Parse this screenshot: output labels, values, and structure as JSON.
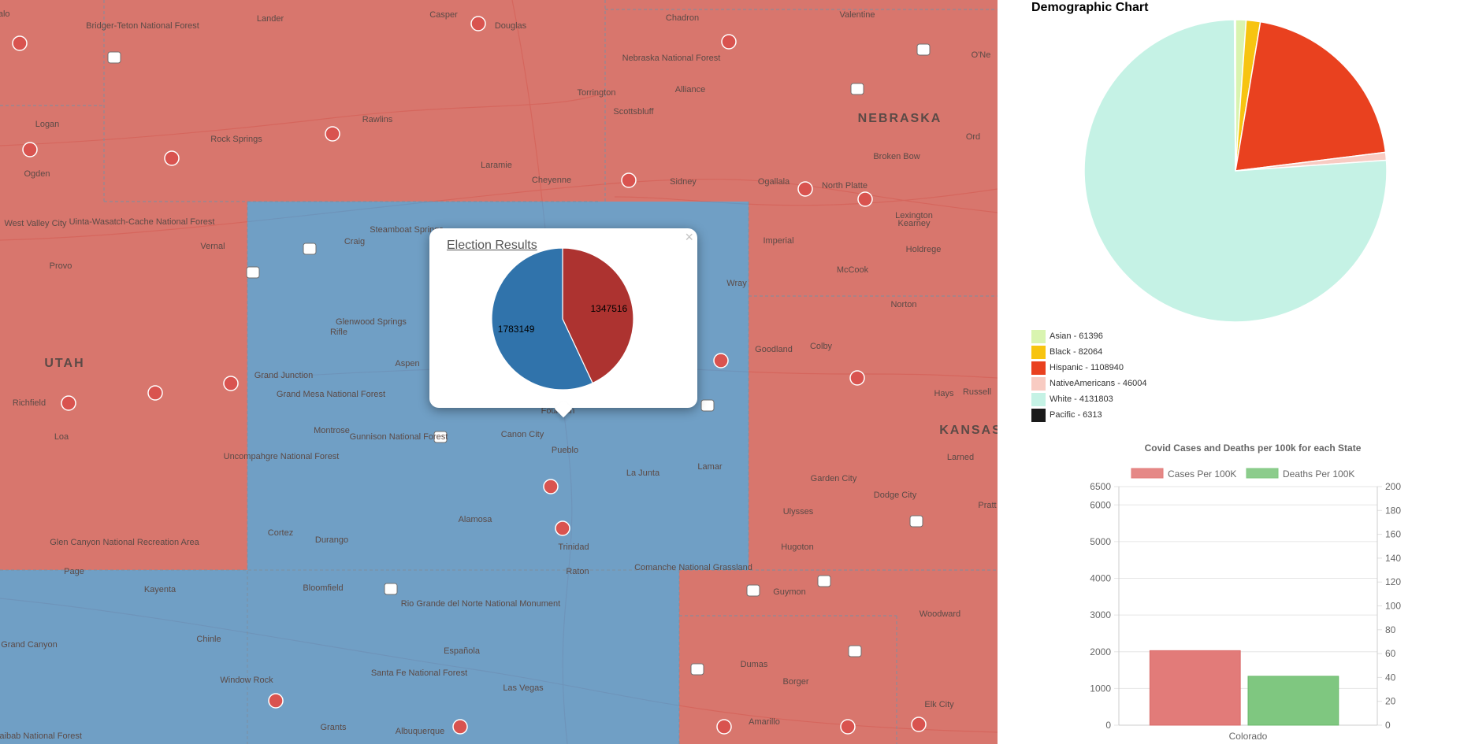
{
  "map": {
    "place_labels": [
      "Etalo",
      "Lander",
      "Casper",
      "Douglas",
      "Chadron",
      "Valentine",
      "O'Ne",
      "Bridger-Teton National Forest",
      "Nebraska National Forest",
      "Torrington",
      "Alliance",
      "Scottsbluff",
      "Rawlins",
      "Rock Springs",
      "Laramie",
      "Cheyenne",
      "Sidney",
      "Ogallala",
      "North Platte",
      "Kearney",
      "Lexington",
      "Broken Bow",
      "Ord",
      "NEBRASKA",
      "Logan",
      "Ogden",
      "West Valley City",
      "Uinta-Wasatch-Cache National Forest",
      "Vernal",
      "Provo",
      "UTAH",
      "Richfield",
      "Loa",
      "Steamboat Springs",
      "Craig",
      "Imperial",
      "McCook",
      "Holdrege",
      "Wray",
      "Glenwood Springs",
      "Rifle",
      "Aspen",
      "Grand Junction",
      "Grand Mesa National Forest",
      "Goodland",
      "Colby",
      "Norton",
      "Hays",
      "Russell",
      "KANSAS",
      "Montrose",
      "Gunnison National Forest",
      "Uncompahgre National Forest",
      "Canon City",
      "Pueblo",
      "La Junta",
      "Lamar",
      "Garden City",
      "Dodge City",
      "Larned",
      "Pratt",
      "Ulysses",
      "Hugoton",
      "Alamosa",
      "Cortez",
      "Durango",
      "Trinidad",
      "Comanche National Grassland",
      "Glen Canyon National Recreation Area",
      "Page",
      "Kayenta",
      "Bloomfield",
      "Rio Grande del Norte National Monument",
      "Guymon",
      "Woodward",
      "Grand Canyon",
      "Chinle",
      "Española",
      "Santa Fe National Forest",
      "Las Vegas",
      "Window Rock",
      "Dumas",
      "Borger",
      "Elk City",
      "Amarillo",
      "Grants",
      "Albuquerque",
      "Kaibab National Forest",
      "Raton",
      "Fountain"
    ]
  },
  "popup": {
    "title": "Election Results",
    "close_label": "×",
    "results": [
      {
        "value": 1783149,
        "color": "#3073ab"
      },
      {
        "value": 1347516,
        "color": "#ad3330"
      }
    ]
  },
  "demographic": {
    "title": "Demographic Chart",
    "legend": [
      {
        "label": "Asian - 61396",
        "color": "#d9f4b0"
      },
      {
        "label": "Black - 82064",
        "color": "#f7c411"
      },
      {
        "label": "Hispanic - 1108940",
        "color": "#e9411f"
      },
      {
        "label": "NativeAmericans - 46004",
        "color": "#f8cbc2"
      },
      {
        "label": "White - 4131803",
        "color": "#c5f2e5"
      },
      {
        "label": "Pacific - 6313",
        "color": "#1a1a1a"
      }
    ]
  },
  "chart_data": [
    {
      "type": "pie",
      "title": "Election Results",
      "labels": [
        "",
        ""
      ],
      "values": [
        1783149,
        1347516
      ],
      "colors": [
        "#3073ab",
        "#ad3330"
      ]
    },
    {
      "type": "pie",
      "title": "Demographic Chart",
      "labels": [
        "Asian",
        "Black",
        "Hispanic",
        "NativeAmericans",
        "White",
        "Pacific"
      ],
      "values": [
        61396,
        82064,
        1108940,
        46004,
        4131803,
        6313
      ],
      "colors": [
        "#d9f4b0",
        "#f7c411",
        "#e9411f",
        "#f8cbc2",
        "#c5f2e5",
        "#1a1a1a"
      ],
      "legend": "bottom-left"
    },
    {
      "type": "bar",
      "title": "Covid Cases and Deaths per 100k for each State",
      "categories": [
        "Colorado"
      ],
      "series": [
        {
          "name": "Cases Per 100K",
          "values": [
            2030
          ],
          "axis": "left",
          "color": "#e27b79"
        },
        {
          "name": "Deaths Per 100K",
          "values": [
            41
          ],
          "axis": "right",
          "color": "#7fc780"
        }
      ],
      "y_left": {
        "ticks": [
          0,
          1000,
          2000,
          3000,
          4000,
          5000,
          6000,
          6500
        ],
        "range": [
          0,
          6500
        ]
      },
      "y_right": {
        "ticks": [
          0,
          20,
          40,
          60,
          80,
          100,
          120,
          140,
          160,
          180,
          200
        ],
        "range": [
          0,
          200
        ]
      },
      "legend": "top",
      "grid": true
    }
  ]
}
